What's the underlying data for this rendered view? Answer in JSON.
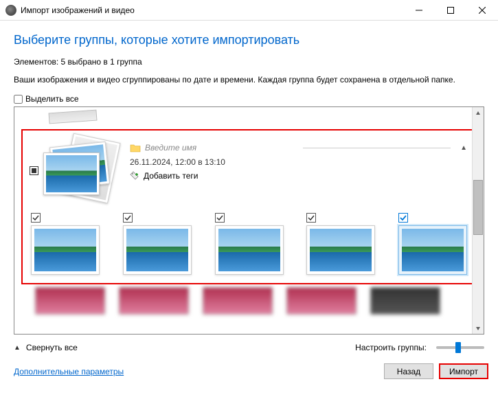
{
  "window": {
    "title": "Импорт изображений и видео"
  },
  "header": {
    "title": "Выберите группы, которые хотите импортировать",
    "summary": "Элементов: 5 выбрано в 1 группа",
    "description": "Ваши изображения и видео сгруппированы по дате и времени. Каждая группа будет сохранена в отдельной папке.",
    "select_all": "Выделить все"
  },
  "group": {
    "name_placeholder": "Введите имя",
    "date": "26.11.2024, 12:00 в 13:10",
    "add_tags": "Добавить теги"
  },
  "bottom": {
    "collapse_all": "Свернуть все",
    "adjust_groups": "Настроить группы:"
  },
  "footer": {
    "more_options": "Дополнительные параметры",
    "back": "Назад",
    "import": "Импорт"
  }
}
